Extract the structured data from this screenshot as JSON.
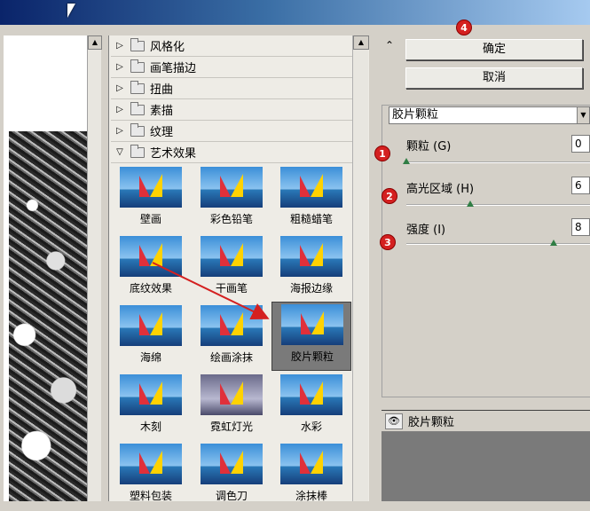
{
  "categories": [
    {
      "label": "风格化",
      "expanded": false
    },
    {
      "label": "画笔描边",
      "expanded": false
    },
    {
      "label": "扭曲",
      "expanded": false
    },
    {
      "label": "素描",
      "expanded": false
    },
    {
      "label": "纹理",
      "expanded": false
    },
    {
      "label": "艺术效果",
      "expanded": true
    }
  ],
  "thumbnails": [
    "壁画",
    "彩色铅笔",
    "粗糙蜡笔",
    "底纹效果",
    "干画笔",
    "海报边缘",
    "海绵",
    "绘画涂抹",
    "胶片颗粒",
    "木刻",
    "霓虹灯光",
    "水彩",
    "塑料包装",
    "调色刀",
    "涂抹棒"
  ],
  "selected_thumbnail": "胶片颗粒",
  "buttons": {
    "ok": "确定",
    "cancel": "取消"
  },
  "filter_select": "胶片颗粒",
  "params": [
    {
      "label": "颗粒 (G)",
      "value": "0",
      "level": 0.0
    },
    {
      "label": "高光区域 (H)",
      "value": "6",
      "level": 0.35
    },
    {
      "label": "强度 (I)",
      "value": "8",
      "level": 0.8
    }
  ],
  "layer": {
    "label": "胶片颗粒",
    "icon": "eye-icon"
  },
  "badges": [
    "1",
    "2",
    "3",
    "4"
  ],
  "colors": {
    "badge": "#d42020",
    "knob": "#2f7d44",
    "arrow": "#d42020"
  }
}
